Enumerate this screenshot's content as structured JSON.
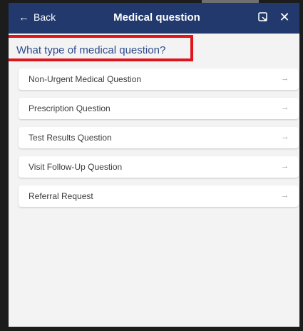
{
  "header": {
    "back_label": "Back",
    "title": "Medical question"
  },
  "question": {
    "heading": "What type of medical question?"
  },
  "options": [
    {
      "label": "Non-Urgent Medical Question"
    },
    {
      "label": "Prescription Question"
    },
    {
      "label": "Test Results Question"
    },
    {
      "label": "Visit Follow-Up Question"
    },
    {
      "label": "Referral Request"
    }
  ],
  "icons": {
    "back": "arrow-left-icon",
    "popout": "popout-icon",
    "close": "close-icon",
    "option_arrow": "arrow-right-icon"
  },
  "colors": {
    "header_background": "#21396d",
    "heading_text": "#2e4a8a",
    "highlight_border": "#e0141b",
    "panel_background": "#f3f3f4"
  }
}
